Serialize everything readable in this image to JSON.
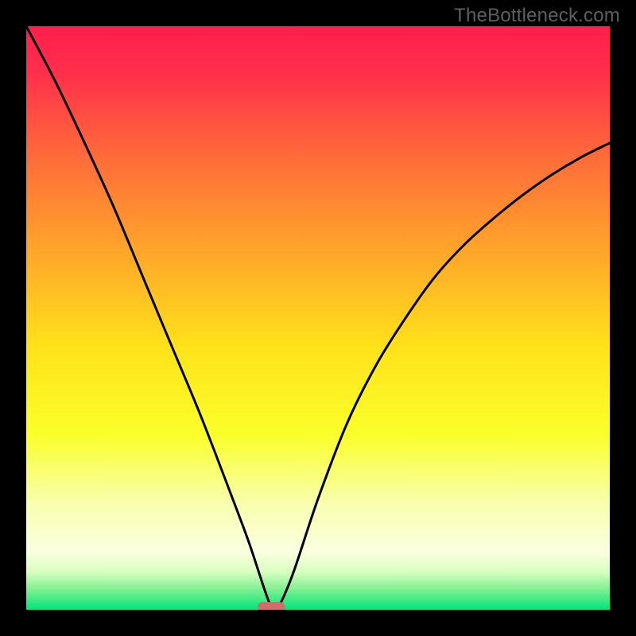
{
  "watermark": "TheBottleneck.com",
  "chart_data": {
    "type": "line",
    "title": "",
    "xlabel": "",
    "ylabel": "",
    "xlim": [
      0,
      100
    ],
    "ylim": [
      0,
      100
    ],
    "grid": false,
    "legend": false,
    "notes": "Unlabeled bottleneck chart. Y appears to be percent bottleneck (0 optimal, 100 worst). X is an unlabeled parameter (likely GPU or CPU relative performance). Curve reaches minimum (~0) near x≈42. A small red marker sits at the minimum. Background is a vertical gradient red→yellow→green top to bottom.",
    "series": [
      {
        "name": "bottleneck-curve",
        "x": [
          0,
          5,
          10,
          15,
          20,
          25,
          30,
          35,
          38,
          40,
          41,
          42,
          43,
          44,
          46,
          50,
          55,
          60,
          65,
          70,
          75,
          80,
          85,
          90,
          95,
          100
        ],
        "values": [
          100,
          90.5,
          80,
          69,
          57,
          45,
          33,
          20,
          12,
          6,
          3,
          0.5,
          0.5,
          2,
          7,
          19,
          32,
          42,
          50,
          57,
          62.5,
          67,
          71,
          74.5,
          77.5,
          80
        ]
      }
    ],
    "marker": {
      "x": 42,
      "y": 0.5,
      "color": "#d46a6a"
    },
    "background_gradient": {
      "stops": [
        {
          "offset": 0.0,
          "color": "#ff1f4b"
        },
        {
          "offset": 0.08,
          "color": "#ff2f4b"
        },
        {
          "offset": 0.22,
          "color": "#ff6a3a"
        },
        {
          "offset": 0.4,
          "color": "#ffab28"
        },
        {
          "offset": 0.55,
          "color": "#ffe21a"
        },
        {
          "offset": 0.7,
          "color": "#faff2a"
        },
        {
          "offset": 0.82,
          "color": "#f8ffb0"
        },
        {
          "offset": 0.9,
          "color": "#fbffe0"
        },
        {
          "offset": 0.935,
          "color": "#d8ffc0"
        },
        {
          "offset": 0.965,
          "color": "#80f090"
        },
        {
          "offset": 1.0,
          "color": "#00e47a"
        }
      ]
    },
    "curve_stroke": "#000000",
    "marker_fill": "#d46a6a"
  }
}
